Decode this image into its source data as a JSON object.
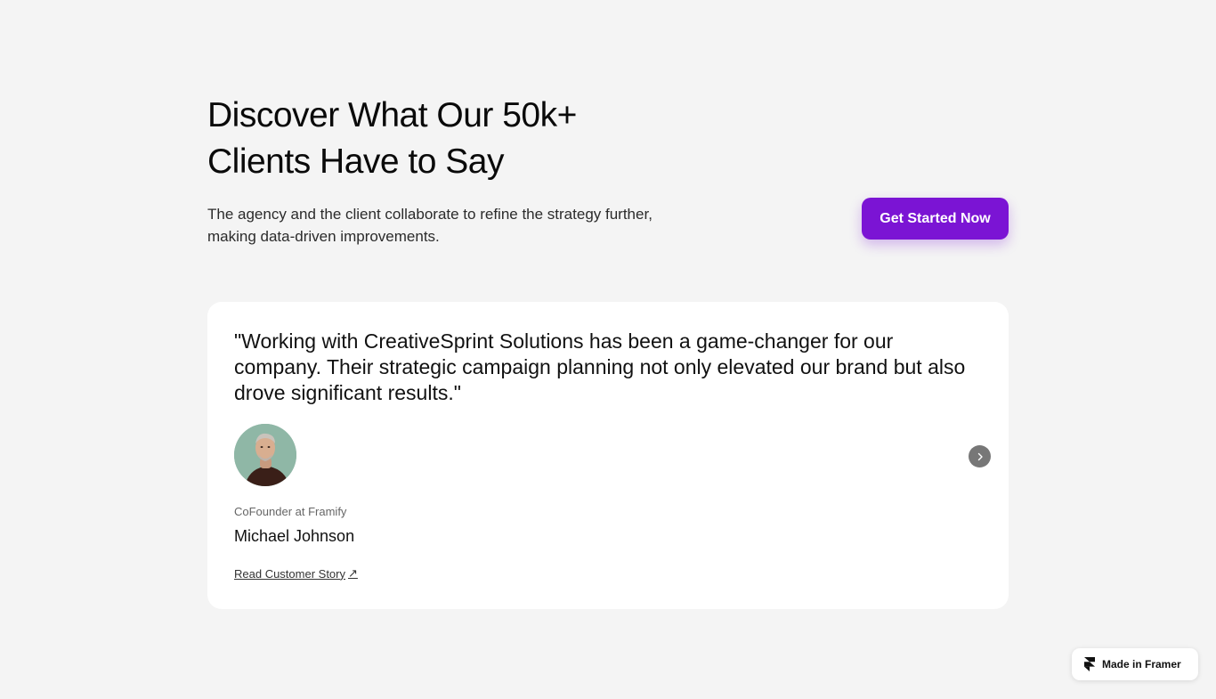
{
  "hero": {
    "title": "Discover What Our 50k+ Clients Have to Say",
    "subtitle": "The agency and the client collaborate to refine the strategy further, making data-driven improvements.",
    "cta_label": "Get Started Now"
  },
  "testimonial": {
    "quote": "\"Working with CreativeSprint Solutions has been a game-changer for our company. Their strategic campaign planning not only elevated our brand but also drove significant results.\"",
    "role": "CoFounder at Framify",
    "name": "Michael Johnson",
    "link_label": "Read Customer Story",
    "link_icon": "↗",
    "next_icon": "chevron-right-icon"
  },
  "badge": {
    "label": "Made in Framer",
    "icon": "framer-logo-icon"
  },
  "colors": {
    "accent": "#7b14d4",
    "background": "#f4f4f4",
    "card": "#ffffff"
  }
}
